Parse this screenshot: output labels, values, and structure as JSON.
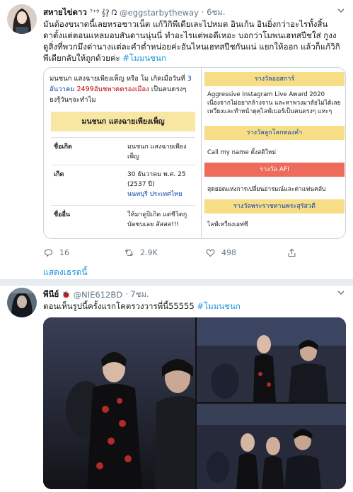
{
  "tweet1": {
    "display_name": "สหายไข่ดาว",
    "name_suffix": "⁷⁺⁹ 𝄞ʔ̥ ᘣ",
    "handle": "@eggstarbytheway",
    "time": "· 6ชม.",
    "text_lines": [
      "มันต้องขนาดนี้เลยหรอชาวเน็ต แก้วิกิพีเดียเละไปหมด อินเก้น อินยิ่งกว่าอะไรทั้งสิ้น",
      "ดาตั้งแต่ตอนแหลมอบสันดานนุ่นนี่ ทำอะไรแต่พอดีเหอะ บอกว่าโมพนเฮทสปีชใส่ กูงง",
      "ดูสิ่งที่พวกมึงด่านางแต่ละคำต่ำหน่อยค่ะอันไหนเฮทสปีชกันแน่ แยกให้ออก แล้วก็แก้วิกิ",
      "พีเดียกลับให้ถูกด้วยค่ะ "
    ],
    "hashtag": "#โมมนชนก",
    "wiki": {
      "intro_1": "มนชนก แสงฉายเพียงเพ็ญ หรือ โม เกิดเมื่อวันที่ ",
      "intro_date": "3",
      "intro_2": "อันวาคม ",
      "intro_red": "2499อันชพาคตรองเมือง",
      "intro_3": " เป็นคนตรงๆ",
      "intro_4": "ยงรุ้วันๆจะทำไม",
      "infobox_title": "มนชนก แสงฉายเพียงเพ็ญ",
      "rows": [
        {
          "key": "ชื่อเกิด",
          "value": "มนชนก แสงฉายเพียงเพ็ญ",
          "link": ""
        },
        {
          "key": "เกิด",
          "value": "30 ธันวาคม พ.ศ. 25 (2537 ปี)",
          "link": "นนทบุรี ประเทศไทย"
        },
        {
          "key": "ชื่ออื่น",
          "value": "ให้มาดูปิเกิด แต่ชีวิตกูบัดซบเลย สัสสส!!!",
          "link": ""
        }
      ],
      "right": [
        {
          "head": "รางวัลออสการ์",
          "style": "gold",
          "text": "Aggressive Instagram Live Award 2020 เนื่องจากไม่อยากล้างจาน และหาพวงมาลัยไม่ได้เลยเหวี่ยงและทำหน้าดุคุไลฟ์เบอร์เป็นคนตรงๆ แหะๆ"
        },
        {
          "head": "รางวัลลูกโลกทองคำ",
          "style": "gold",
          "text": "Call my name ตั้งสติใหม่"
        },
        {
          "head": "รางวัล AFI",
          "style": "red",
          "text": "สุดยอดแห่งการเปลี่ยนอารมณ์และด่าแฟนคลับ"
        },
        {
          "head": "รางวัลพระราชทานพระสุรัสวดี",
          "style": "gold",
          "text": "ไลฟ์เหวี่ยงเอฟซี"
        }
      ]
    },
    "actions": {
      "reply": "16",
      "retweet": "2.9K",
      "like": "498"
    },
    "show_thread": "แสดงเธรดนี้"
  },
  "tweet2": {
    "display_name": "พีนีย์",
    "name_suffix": "🐞",
    "handle": "@NIE612BD",
    "time": "· 7ชม.",
    "text": "ตอนเห็นรูปนี้ครั้งแรกโคตรวงวารพี่นี้55555 ",
    "hashtag": "#โมมนชนก"
  },
  "colors": {
    "link": "#1b95e0",
    "muted": "#657786",
    "wiki_gold": "#f6dd86",
    "wiki_red": "#ee6b5b"
  },
  "icons": [
    "chevron-down-icon",
    "reply-icon",
    "retweet-icon",
    "like-icon",
    "share-icon"
  ]
}
